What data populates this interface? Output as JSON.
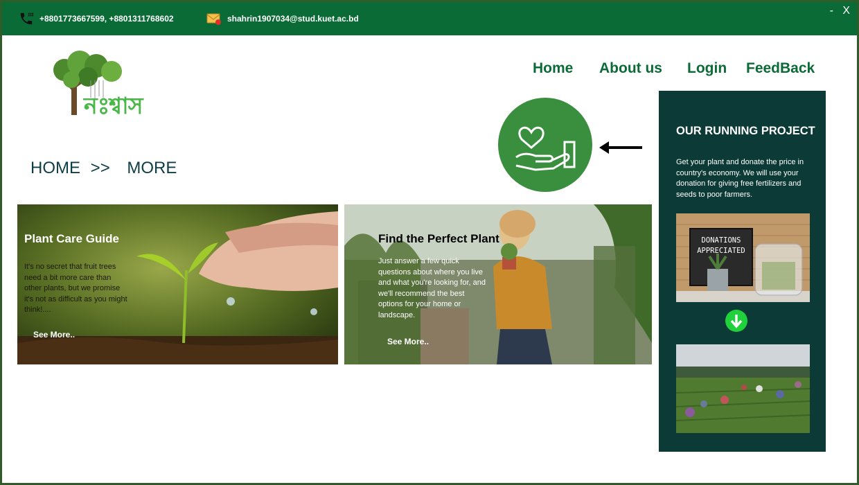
{
  "topbar": {
    "phone": "+8801773667599, +8801311768602",
    "email": "shahrin1907034@stud.kuet.ac.bd",
    "minimize": "-",
    "close": "X"
  },
  "logo": {
    "text": "নঃশ্বাস"
  },
  "nav": {
    "home": "Home",
    "about": "About us",
    "login": "Login",
    "feedback": "FeedBack"
  },
  "breadcrumb": {
    "home": "HOME",
    "separator": ">>",
    "current": "MORE"
  },
  "cards": [
    {
      "title": "Plant Care Guide",
      "text": "It's no secret that fruit trees need a bit more care than other plants, but we promise it's not as difficult as you might think!....",
      "more": "See More.."
    },
    {
      "title": "Find the Perfect Plant",
      "text": "Just answer a few quick questions about where you live and what you're looking for, and we'll recommend the best options for your home or landscape.",
      "more": "See More.."
    }
  ],
  "panel": {
    "title": "OUR RUNNING PROJECT",
    "text": "Get your plant and donate the price in country's economy. We will use your donation for giving free fertilizers and seeds to poor farmers.",
    "sign_line1": "DONATIONS",
    "sign_line2": "APPRECIATED"
  },
  "colors": {
    "topbar": "#0b6b36",
    "nav": "#0b6b36",
    "panel": "#0c3a36",
    "badge": "#3a8f3f",
    "arrow_badge": "#1fd13a"
  }
}
